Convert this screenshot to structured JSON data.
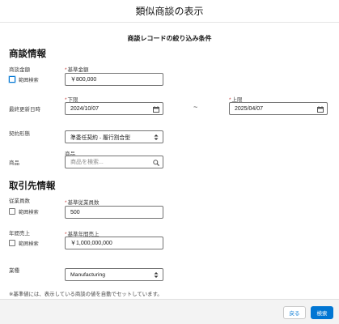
{
  "header": {
    "title": "類似商談の表示"
  },
  "subtitle": "商談レコードの絞り込み条件",
  "opportunity_section": {
    "title": "商談情報",
    "amount": {
      "label": "商談金額",
      "range_checkbox_label": "範囲検索",
      "base_label": "基準金額",
      "value": "￥800,000"
    },
    "last_modified": {
      "label": "最終更新日時",
      "lower_label": "下限",
      "lower_value": "2024/10/07",
      "range_separator": "~",
      "upper_label": "上限",
      "upper_value": "2025/04/07",
      "calendar_icon": "calendar-icon"
    },
    "contract_type": {
      "label": "契約形態",
      "selected": "準委任契約 - 履行割合型"
    },
    "product": {
      "label": "商品",
      "field_label": "商品",
      "placeholder": "商品を検索...",
      "search_icon": "search-icon"
    }
  },
  "account_section": {
    "title": "取引先情報",
    "employees": {
      "label": "従業員数",
      "range_checkbox_label": "範囲検索",
      "base_label": "基準従業員数",
      "value": "500"
    },
    "revenue": {
      "label": "年間売上",
      "range_checkbox_label": "範囲検索",
      "base_label": "基準年間売上",
      "value": "￥1,000,000,000"
    },
    "industry": {
      "label": "業種",
      "selected": "Manufacturing"
    }
  },
  "note": "※基準値には、表示している商談の値を自動でセットしています。",
  "footer": {
    "back_label": "戻る",
    "search_label": "検索"
  },
  "colors": {
    "brand": "#0176d3",
    "required": "#c23934"
  }
}
